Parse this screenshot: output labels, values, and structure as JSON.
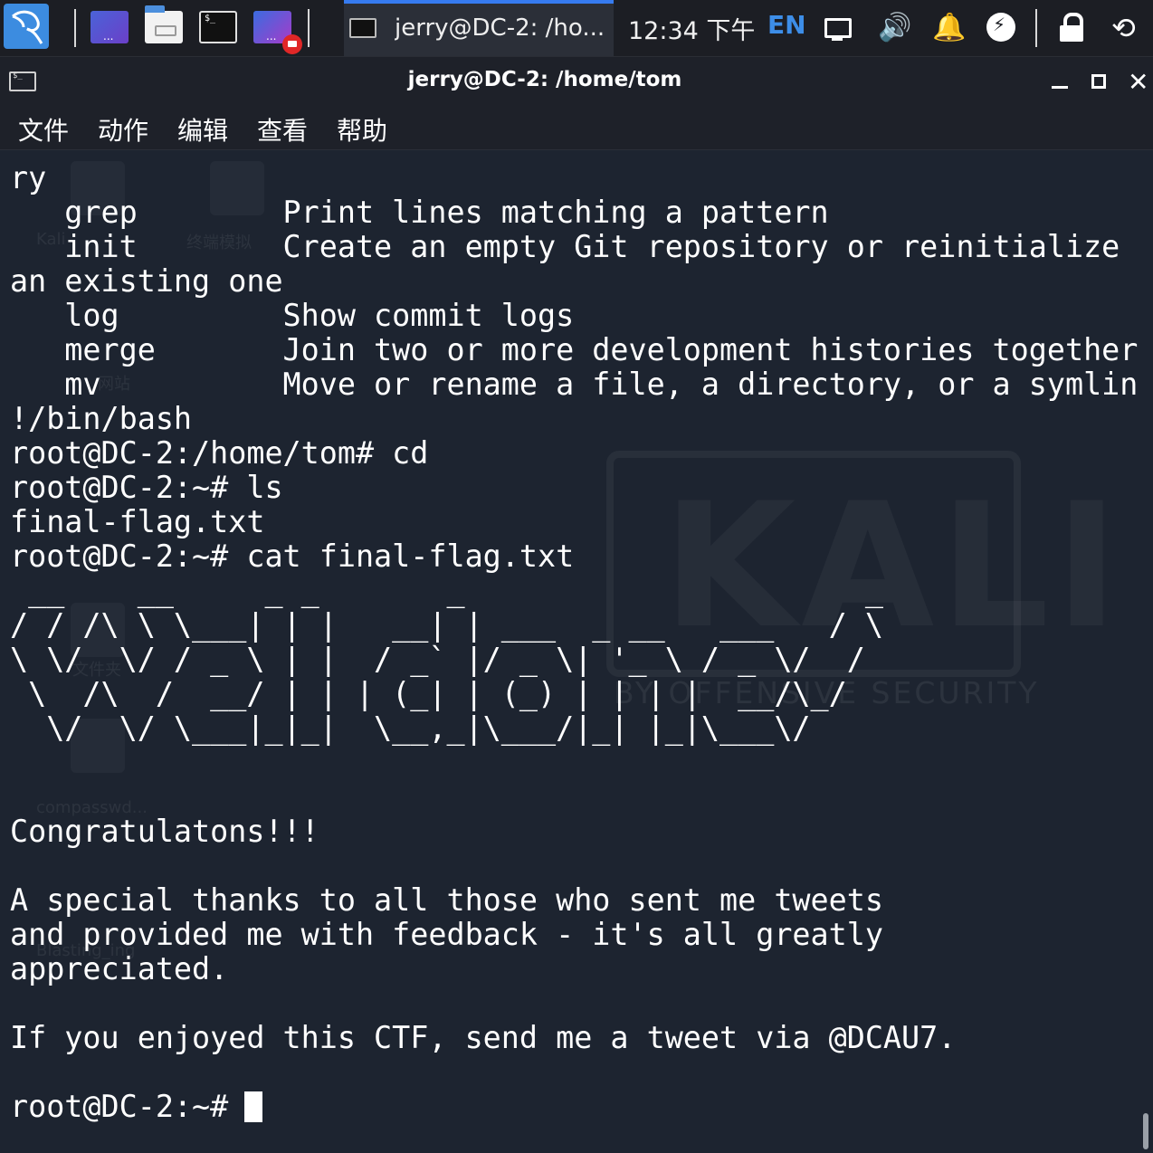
{
  "panel": {
    "desktop_label": "...",
    "terminal_label": "$_",
    "recorder_label": "...",
    "task_title": "jerry@DC-2: /ho...",
    "clock": "12:34 下午",
    "lang": "EN"
  },
  "window": {
    "title": "jerry@DC-2: /home/tom",
    "menu": [
      "文件",
      "动作",
      "编辑",
      "查看",
      "帮助"
    ]
  },
  "desktop_ghosts": {
    "kali": "Kali",
    "terminal": "终端模拟",
    "station": "网站",
    "file": "文件夹",
    "compasswd": "compasswd...",
    "blasting": "Blasting_ing"
  },
  "watermark": {
    "brand": "KALI",
    "tagline": "BY OFFENSIVE SECURITY"
  },
  "terminal": {
    "lines": [
      "ry",
      "   grep        Print lines matching a pattern",
      "   init        Create an empty Git repository or reinitialize",
      "an existing one",
      "   log         Show commit logs",
      "   merge       Join two or more development histories together",
      "   mv          Move or rename a file, a directory, or a symlin",
      "!/bin/bash",
      "root@DC-2:/home/tom# cd",
      "root@DC-2:~# ls",
      "final-flag.txt",
      "root@DC-2:~# cat final-flag.txt",
      " __    __     _ _       _                      _ ",
      "/ / /\\ \\ \\___| | |   __| | ___  _ __   ___   / \\",
      "\\ \\/  \\/ / _ \\ | |  / _` |/ _ \\| '_ \\ / _ \\/  /",
      " \\  /\\  /  __/ | | | (_| | (_) | | | |  __/\\_/",
      "  \\/  \\/ \\___|_|_|  \\__,_|\\___/|_| |_|\\___\\/",
      "",
      "",
      "Congratulatons!!!",
      "",
      "A special thanks to all those who sent me tweets",
      "and provided me with feedback - it's all greatly",
      "appreciated.",
      "",
      "If you enjoyed this CTF, send me a tweet via @DCAU7.",
      "",
      "root@DC-2:~# "
    ]
  }
}
